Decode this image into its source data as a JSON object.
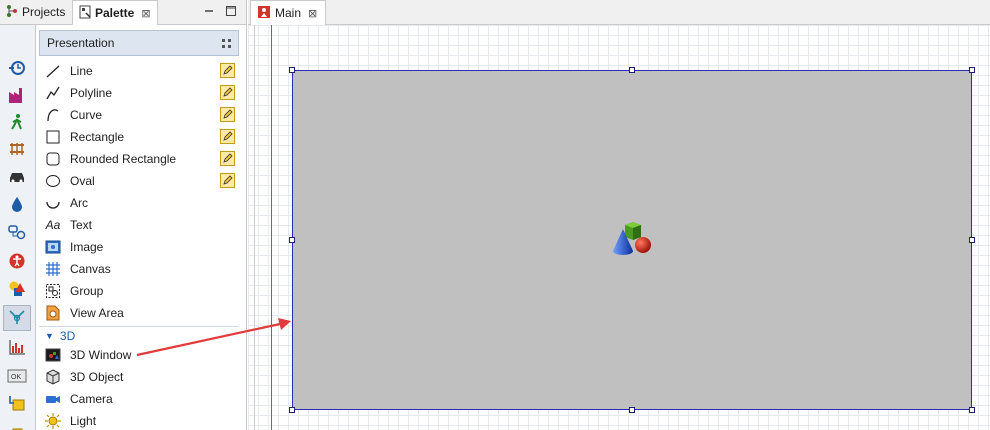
{
  "tabs_left": {
    "projects": "Projects",
    "palette": "Palette",
    "close": "⊠"
  },
  "editor_tab": {
    "label": "Main",
    "close": "⊠"
  },
  "palette": {
    "header": "Presentation",
    "items": [
      {
        "label": "Line",
        "icon": "line-icon",
        "editable": true
      },
      {
        "label": "Polyline",
        "icon": "polyline-icon",
        "editable": true
      },
      {
        "label": "Curve",
        "icon": "curve-icon",
        "editable": true
      },
      {
        "label": "Rectangle",
        "icon": "rectangle-icon",
        "editable": true
      },
      {
        "label": "Rounded Rectangle",
        "icon": "rounded-rectangle-icon",
        "editable": true
      },
      {
        "label": "Oval",
        "icon": "oval-icon",
        "editable": true
      },
      {
        "label": "Arc",
        "icon": "arc-icon",
        "editable": false
      },
      {
        "label": "Text",
        "icon": "text-icon",
        "glyph": "Aa",
        "editable": false
      },
      {
        "label": "Image",
        "icon": "image-icon",
        "editable": false
      },
      {
        "label": "Canvas",
        "icon": "canvas-icon",
        "editable": false
      },
      {
        "label": "Group",
        "icon": "group-icon",
        "editable": false
      },
      {
        "label": "View Area",
        "icon": "view-area-icon",
        "editable": false
      }
    ],
    "section_3d": {
      "title": "3D",
      "items": [
        {
          "label": "3D Window",
          "icon": "3d-window-icon"
        },
        {
          "label": "3D Object",
          "icon": "3d-object-icon"
        },
        {
          "label": "Camera",
          "icon": "camera-icon"
        },
        {
          "label": "Light",
          "icon": "light-icon"
        }
      ]
    }
  },
  "categories": [
    "blank-category-icon",
    "process-modeling-icon",
    "factory-icon",
    "pedestrian-icon",
    "rail-icon",
    "road-traffic-icon",
    "fluid-icon",
    "agent-icon",
    "accessibility-icon",
    "presentation-icon",
    "space-markup-icon",
    "analysis-icon",
    "controls-icon",
    "connectivity-icon"
  ],
  "colors": {
    "selection_border": "#2b2bc4",
    "window_fill": "#c0c0c0",
    "arrow": "#e23b3b",
    "section_text": "#1f5ca8"
  }
}
